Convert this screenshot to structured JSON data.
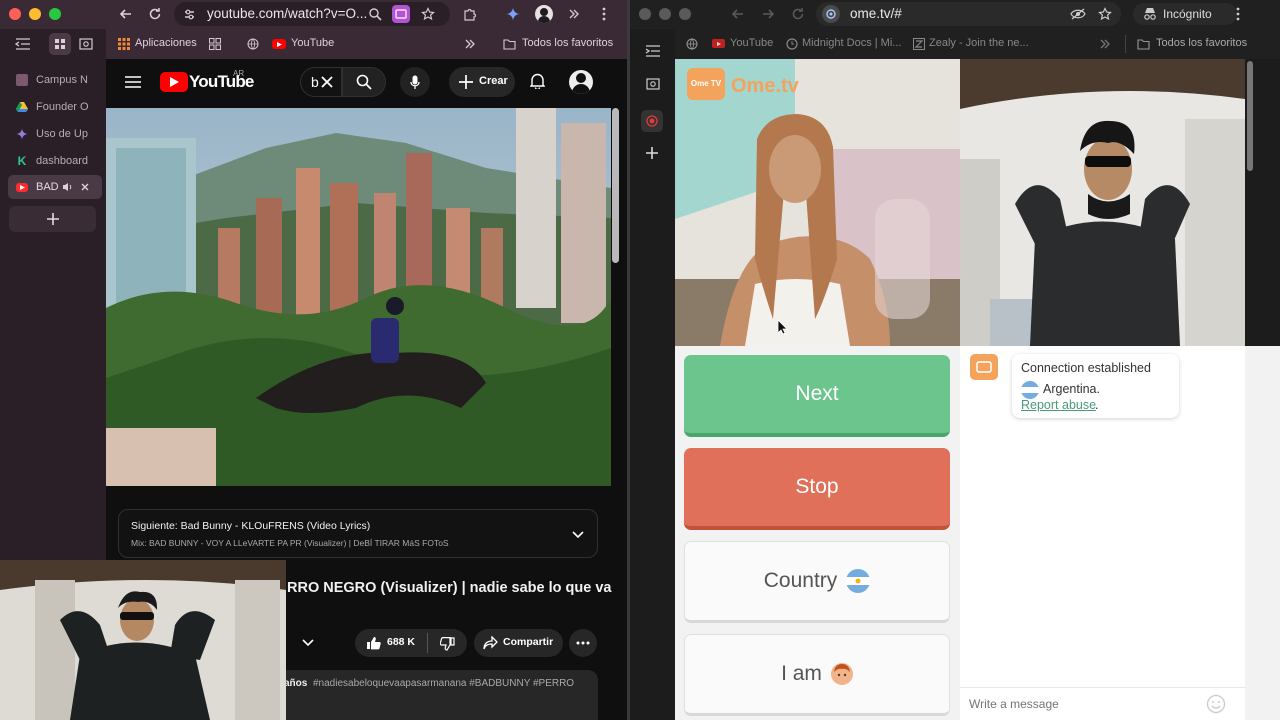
{
  "left_window": {
    "url": "youtube.com/watch?v=O...",
    "bookmarks": {
      "apps": "Aplicaciones",
      "youtube": "YouTube",
      "all": "Todos los favoritos"
    },
    "tabs": [
      {
        "label": "Campus N",
        "color": "#7a5a6e"
      },
      {
        "label": "Founder O",
        "color": "#6ea0e8"
      },
      {
        "label": "Uso de Up",
        "color": "#9a7ad8"
      },
      {
        "label": "dashboard",
        "color": "#2ec98a"
      },
      {
        "label": "BAD",
        "color": "#ff2a2a"
      }
    ],
    "youtube": {
      "logo_text": "YouTube",
      "region": "AR",
      "search_value": "b",
      "create_label": "Crear",
      "next_label": "Siguiente: Bad Bunny - KLOuFRENS (Video Lyrics)",
      "mix_label": "Mix: BAD BUNNY - VOY A LLeVARTE PA PR (Visualizer) | DeBÍ TIRAR MáS FOToS",
      "title": "RRO NEGRO (Visualizer) | nadie sabe lo que va",
      "likes": "688 K",
      "share_label": "Compartir",
      "desc_age": "años",
      "hashtags": "#nadiesabeloquevaapasarmanana #BADBUNNY #PERRO"
    }
  },
  "right_window": {
    "url": "ome.tv/#",
    "incognito_label": "Incógnito",
    "bookmarks": {
      "youtube": "YouTube",
      "midnight": "Midnight Docs | Mi...",
      "zealy": "Zealy - Join the ne...",
      "all": "Todos los favoritos"
    },
    "ometv": {
      "logo_text": "Ome.tv",
      "logo_badge": "Ome TV",
      "next_label": "Next",
      "stop_label": "Stop",
      "country_label": "Country",
      "iam_label": "I am",
      "chat_status": "Connection established",
      "chat_country": "Argentina.",
      "report_label": "Report abuse",
      "message_placeholder": "Write a message"
    }
  },
  "colors": {
    "next_green": "#6cc58d",
    "stop_red": "#e0705a",
    "ome_orange": "#f3a35c",
    "link": "#4a9a78"
  }
}
